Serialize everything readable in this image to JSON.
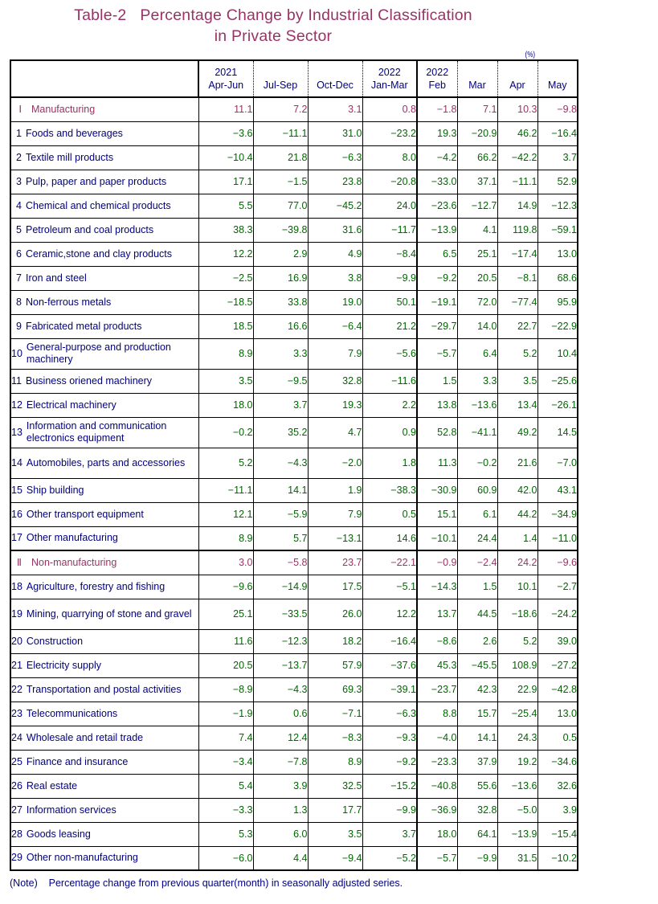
{
  "title": {
    "line1": "Table-2   Percentage Change by Industrial Classification",
    "line2": "in Private Sector"
  },
  "unit": "(%)",
  "note": "(Note)    Percentage change from previous quarter(month) in seasonally adjusted series.",
  "colors": {
    "section_text": "#993366",
    "label_text": "#000080",
    "value_text": "#006600",
    "border": "#000000"
  },
  "header": {
    "blank_label": "",
    "quarters": [
      {
        "year": "2021",
        "period": "Apr-Jun"
      },
      {
        "year": "",
        "period": "Jul-Sep"
      },
      {
        "year": "",
        "period": "Oct-Dec"
      },
      {
        "year": "2022",
        "period": "Jan-Mar"
      }
    ],
    "months": [
      {
        "year": "2022",
        "period": "Feb"
      },
      {
        "year": "",
        "period": "Mar"
      },
      {
        "year": "",
        "period": "Apr"
      },
      {
        "year": "",
        "period": "May"
      }
    ]
  },
  "rows": [
    {
      "num": "Ⅰ",
      "label": "Manufacturing",
      "section": true,
      "tall": false,
      "values": [
        "11.1",
        "7.2",
        "3.1",
        "0.8",
        "−1.8",
        "7.1",
        "10.3",
        "−9.8"
      ]
    },
    {
      "num": "1",
      "label": "Foods and beverages",
      "section": false,
      "tall": false,
      "values": [
        "−3.6",
        "−11.1",
        "31.0",
        "−23.2",
        "19.3",
        "−20.9",
        "46.2",
        "−16.4"
      ]
    },
    {
      "num": "2",
      "label": "Textile mill products",
      "section": false,
      "tall": false,
      "values": [
        "−10.4",
        "21.8",
        "−6.3",
        "8.0",
        "−4.2",
        "66.2",
        "−42.2",
        "3.7"
      ]
    },
    {
      "num": "3",
      "label": "Pulp, paper and paper products",
      "section": false,
      "tall": false,
      "values": [
        "17.1",
        "−1.5",
        "23.8",
        "−20.8",
        "−33.0",
        "37.1",
        "−11.1",
        "52.9"
      ]
    },
    {
      "num": "4",
      "label": "Chemical and chemical products",
      "section": false,
      "tall": false,
      "values": [
        "5.5",
        "77.0",
        "−45.2",
        "24.0",
        "−23.6",
        "−12.7",
        "14.9",
        "−12.3"
      ]
    },
    {
      "num": "5",
      "label": "Petroleum and coal products",
      "section": false,
      "tall": false,
      "values": [
        "38.3",
        "−39.8",
        "31.6",
        "−11.7",
        "−13.9",
        "4.1",
        "119.8",
        "−59.1"
      ]
    },
    {
      "num": "6",
      "label": "Ceramic,stone and clay products",
      "section": false,
      "tall": false,
      "values": [
        "12.2",
        "2.9",
        "4.9",
        "−8.4",
        "6.5",
        "25.1",
        "−17.4",
        "13.0"
      ]
    },
    {
      "num": "7",
      "label": "Iron and steel",
      "section": false,
      "tall": false,
      "values": [
        "−2.5",
        "16.9",
        "3.8",
        "−9.9",
        "−9.2",
        "20.5",
        "−8.1",
        "68.6"
      ]
    },
    {
      "num": "8",
      "label": "Non-ferrous metals",
      "section": false,
      "tall": false,
      "values": [
        "−18.5",
        "33.8",
        "19.0",
        "50.1",
        "−19.1",
        "72.0",
        "−77.4",
        "95.9"
      ]
    },
    {
      "num": "9",
      "label": "Fabricated metal products",
      "section": false,
      "tall": false,
      "values": [
        "18.5",
        "16.6",
        "−6.4",
        "21.2",
        "−29.7",
        "14.0",
        "22.7",
        "−22.9"
      ]
    },
    {
      "num": "10",
      "label": "General-purpose and production machinery",
      "section": false,
      "tall": true,
      "values": [
        "8.9",
        "3.3",
        "7.9",
        "−5.6",
        "−5.7",
        "6.4",
        "5.2",
        "10.4"
      ]
    },
    {
      "num": "11",
      "label": "Business oriened machinery",
      "section": false,
      "tall": false,
      "values": [
        "3.5",
        "−9.5",
        "32.8",
        "−11.6",
        "1.5",
        "3.3",
        "3.5",
        "−25.6"
      ]
    },
    {
      "num": "12",
      "label": "Electrical machinery",
      "section": false,
      "tall": false,
      "values": [
        "18.0",
        "3.7",
        "19.3",
        "2.2",
        "13.8",
        "−13.6",
        "13.4",
        "−26.1"
      ]
    },
    {
      "num": "13",
      "label": "Information and communication electronics equipment",
      "section": false,
      "tall": true,
      "values": [
        "−0.2",
        "35.2",
        "4.7",
        "0.9",
        "52.8",
        "−41.1",
        "49.2",
        "14.5"
      ]
    },
    {
      "num": "14",
      "label": "Automobiles, parts and accessories",
      "section": false,
      "tall": true,
      "values": [
        "5.2",
        "−4.3",
        "−2.0",
        "1.8",
        "11.3",
        "−0.2",
        "21.6",
        "−7.0"
      ]
    },
    {
      "num": "15",
      "label": "Ship building",
      "section": false,
      "tall": false,
      "values": [
        "−11.1",
        "14.1",
        "1.9",
        "−38.3",
        "−30.9",
        "60.9",
        "42.0",
        "43.1"
      ]
    },
    {
      "num": "16",
      "label": "Other transport equipment",
      "section": false,
      "tall": false,
      "values": [
        "12.1",
        "−5.9",
        "7.9",
        "0.5",
        "15.1",
        "6.1",
        "44.2",
        "−34.9"
      ]
    },
    {
      "num": "17",
      "label": "Other manufacturing",
      "section": false,
      "tall": false,
      "values": [
        "8.9",
        "5.7",
        "−13.1",
        "14.6",
        "−10.1",
        "24.4",
        "1.4",
        "−11.0"
      ]
    },
    {
      "num": "Ⅱ",
      "label": "Non-manufacturing",
      "section": true,
      "tall": false,
      "values": [
        "3.0",
        "−5.8",
        "23.7",
        "−22.1",
        "−0.9",
        "−2.4",
        "24.2",
        "−9.6"
      ]
    },
    {
      "num": "18",
      "label": "Agriculture, forestry and fishing",
      "section": false,
      "tall": false,
      "values": [
        "−9.6",
        "−14.9",
        "17.5",
        "−5.1",
        "−14.3",
        "1.5",
        "10.1",
        "−2.7"
      ]
    },
    {
      "num": "19",
      "label": "Mining, quarrying of stone and gravel",
      "section": false,
      "tall": true,
      "values": [
        "25.1",
        "−33.5",
        "26.0",
        "12.2",
        "13.7",
        "44.5",
        "−18.6",
        "−24.2"
      ]
    },
    {
      "num": "20",
      "label": "Construction",
      "section": false,
      "tall": false,
      "values": [
        "11.6",
        "−12.3",
        "18.2",
        "−16.4",
        "−8.6",
        "2.6",
        "5.2",
        "39.0"
      ]
    },
    {
      "num": "21",
      "label": "Electricity supply",
      "section": false,
      "tall": false,
      "values": [
        "20.5",
        "−13.7",
        "57.9",
        "−37.6",
        "45.3",
        "−45.5",
        "108.9",
        "−27.2"
      ]
    },
    {
      "num": "22",
      "label": "Transportation and postal activities",
      "section": false,
      "tall": false,
      "values": [
        "−8.9",
        "−4.3",
        "69.3",
        "−39.1",
        "−23.7",
        "42.3",
        "22.9",
        "−42.8"
      ]
    },
    {
      "num": "23",
      "label": "Telecommunications",
      "section": false,
      "tall": false,
      "values": [
        "−1.9",
        "0.6",
        "−7.1",
        "−6.3",
        "8.8",
        "15.7",
        "−25.4",
        "13.0"
      ]
    },
    {
      "num": "24",
      "label": "Wholesale and retail trade",
      "section": false,
      "tall": false,
      "values": [
        "7.4",
        "12.4",
        "−8.3",
        "−9.3",
        "−4.0",
        "14.1",
        "24.3",
        "0.5"
      ]
    },
    {
      "num": "25",
      "label": "Finance and insurance",
      "section": false,
      "tall": false,
      "values": [
        "−3.4",
        "−7.8",
        "8.9",
        "−9.2",
        "−23.3",
        "37.9",
        "19.2",
        "−34.6"
      ]
    },
    {
      "num": "26",
      "label": "Real estate",
      "section": false,
      "tall": false,
      "values": [
        "5.4",
        "3.9",
        "32.5",
        "−15.2",
        "−40.8",
        "55.6",
        "−13.6",
        "32.6"
      ]
    },
    {
      "num": "27",
      "label": "Information services",
      "section": false,
      "tall": false,
      "values": [
        "−3.3",
        "1.3",
        "17.7",
        "−9.9",
        "−36.9",
        "32.8",
        "−5.0",
        "3.9"
      ]
    },
    {
      "num": "28",
      "label": "Goods leasing",
      "section": false,
      "tall": false,
      "values": [
        "5.3",
        "6.0",
        "3.5",
        "3.7",
        "18.0",
        "64.1",
        "−13.9",
        "−15.4"
      ]
    },
    {
      "num": "29",
      "label": "Other non-manufacturing",
      "section": false,
      "tall": false,
      "values": [
        "−6.0",
        "4.4",
        "−9.4",
        "−5.2",
        "−5.7",
        "−9.9",
        "31.5",
        "−10.2"
      ]
    }
  ]
}
